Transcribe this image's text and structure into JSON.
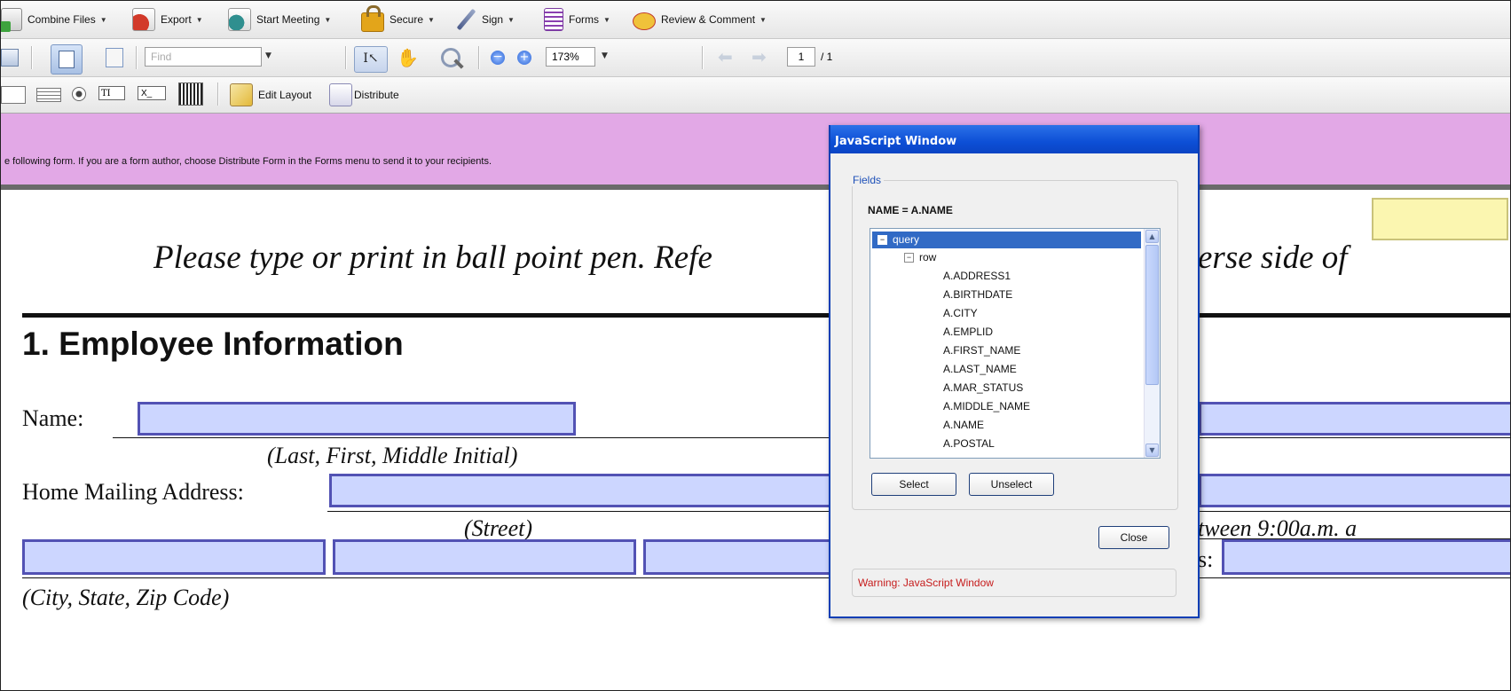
{
  "toolbar1": {
    "combine": "Combine Files",
    "export": "Export",
    "meeting": "Start Meeting",
    "secure": "Secure",
    "sign": "Sign",
    "forms": "Forms",
    "review": "Review & Comment"
  },
  "toolbar2": {
    "find_placeholder": "Find",
    "zoom": "173%",
    "page_current": "1",
    "page_total": "/ 1"
  },
  "toolbar3": {
    "edit_layout": "Edit Layout",
    "distribute": "Distribute"
  },
  "notification": {
    "text": "e following form. If you are a form author, choose Distribute Form in the Forms menu to send it to your recipients."
  },
  "document": {
    "instructions_left": "Please type or print in ball point pen. Refe",
    "instructions_right": "erse side of",
    "section_title": "1. Employee Information",
    "name_label": "Name:",
    "name_hint": "(Last, First, Middle Initial)",
    "address_label": "Home Mailing Address:",
    "street_hint": "(Street)",
    "time_fragment": "tween 9:00a.m. a",
    "s_fragment": "s:",
    "city_hint": "(City, State, Zip Code)"
  },
  "dialog": {
    "title": "JavaScript Window",
    "fields_legend": "Fields",
    "name_line": "NAME = A.NAME",
    "tree_root": "query",
    "tree_row": "row",
    "tree_items": [
      "A.ADDRESS1",
      "A.BIRTHDATE",
      "A.CITY",
      "A.EMPLID",
      "A.FIRST_NAME",
      "A.LAST_NAME",
      "A.MAR_STATUS",
      "A.MIDDLE_NAME",
      "A.NAME",
      "A.POSTAL"
    ],
    "select_label": "Select",
    "unselect_label": "Unselect",
    "close_label": "Close",
    "warning": "Warning: JavaScript Window"
  },
  "colors": {
    "field_fill": "#ccd6ff",
    "field_border": "#5252b4",
    "notify_bg": "#e2a8e6",
    "title_bar": "#0d4fd6",
    "tree_selected": "#316ac5",
    "warning_text": "#c61b1b"
  }
}
